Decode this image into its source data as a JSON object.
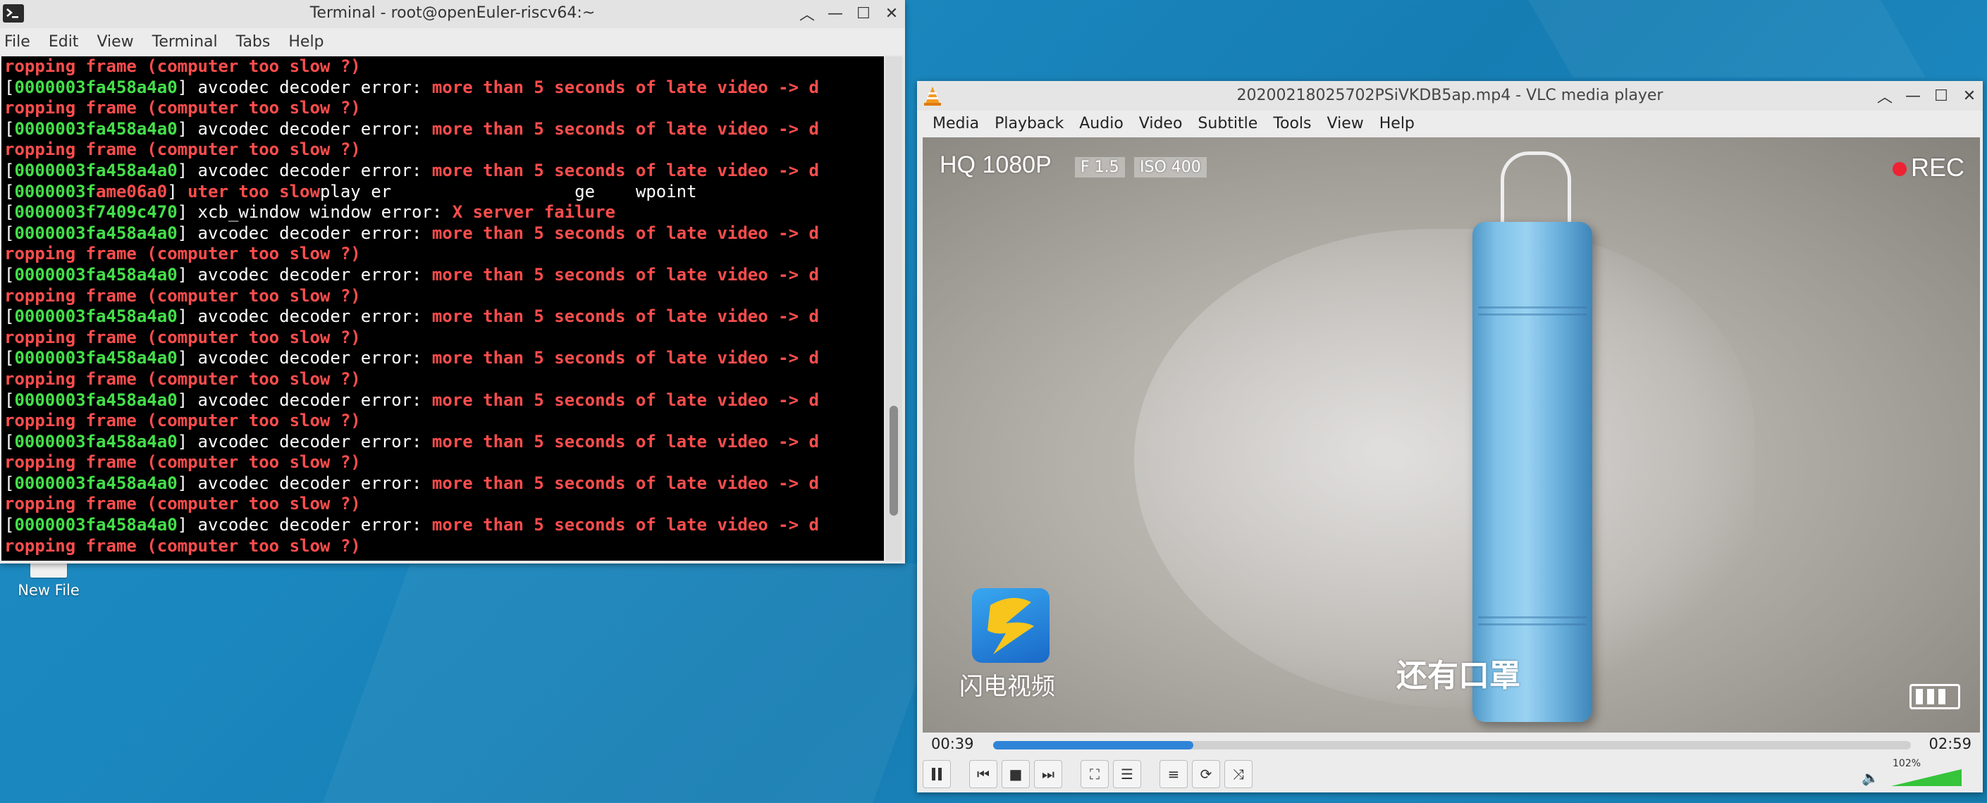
{
  "desktop": {
    "icon_label": "New File"
  },
  "terminal": {
    "title": "Terminal - root@openEuler-riscv64:~",
    "menu": [
      "File",
      "Edit",
      "View",
      "Terminal",
      "Tabs",
      "Help"
    ],
    "lines": [
      [
        {
          "t": "ropping frame (computer too slow ?)",
          "c": "red"
        }
      ],
      [
        {
          "t": "[",
          "c": "wht"
        },
        {
          "t": "0000003fa458a4a0",
          "c": "id"
        },
        {
          "t": "] avcodec decoder error: ",
          "c": "wht"
        },
        {
          "t": "more than 5 seconds of late video -> d",
          "c": "red"
        }
      ],
      [
        {
          "t": "ropping frame (computer too slow ?)",
          "c": "red"
        }
      ],
      [
        {
          "t": "[",
          "c": "wht"
        },
        {
          "t": "0000003fa458a4a0",
          "c": "id"
        },
        {
          "t": "] avcodec decoder error: ",
          "c": "wht"
        },
        {
          "t": "more than 5 seconds of late video -> d",
          "c": "red"
        }
      ],
      [
        {
          "t": "ropping frame (computer too slow ?)",
          "c": "red"
        }
      ],
      [
        {
          "t": "[",
          "c": "wht"
        },
        {
          "t": "0000003fa458a4a0",
          "c": "id"
        },
        {
          "t": "] avcodec decoder error: ",
          "c": "wht"
        },
        {
          "t": "more than 5 seconds of late video -> d",
          "c": "red"
        }
      ],
      [
        {
          "t": "[",
          "c": "wht"
        },
        {
          "t": "0000003f",
          "c": "id"
        },
        {
          "t": "ame06a0",
          "c": "red"
        },
        {
          "t": "] ",
          "c": "wht"
        },
        {
          "t": "uter too slow",
          "c": "red"
        },
        {
          "t": "play er          ",
          "c": "wht"
        },
        {
          "t": "        ge    wpoint",
          "c": "wht"
        }
      ],
      [
        {
          "t": "[",
          "c": "wht"
        },
        {
          "t": "0000003f7409c470",
          "c": "id"
        },
        {
          "t": "] xcb_window window error: ",
          "c": "wht"
        },
        {
          "t": "X server failure",
          "c": "red"
        }
      ],
      [
        {
          "t": "[",
          "c": "wht"
        },
        {
          "t": "0000003fa458a4a0",
          "c": "id"
        },
        {
          "t": "] avcodec decoder error: ",
          "c": "wht"
        },
        {
          "t": "more than 5 seconds of late video -> d",
          "c": "red"
        }
      ],
      [
        {
          "t": "ropping frame (computer too slow ?)",
          "c": "red"
        }
      ],
      [
        {
          "t": "[",
          "c": "wht"
        },
        {
          "t": "0000003fa458a4a0",
          "c": "id"
        },
        {
          "t": "] avcodec decoder error: ",
          "c": "wht"
        },
        {
          "t": "more than 5 seconds of late video -> d",
          "c": "red"
        }
      ],
      [
        {
          "t": "ropping frame (computer too slow ?)",
          "c": "red"
        }
      ],
      [
        {
          "t": "[",
          "c": "wht"
        },
        {
          "t": "0000003fa458a4a0",
          "c": "id"
        },
        {
          "t": "] avcodec decoder error: ",
          "c": "wht"
        },
        {
          "t": "more than 5 seconds of late video -> d",
          "c": "red"
        }
      ],
      [
        {
          "t": "ropping frame (computer too slow ?)",
          "c": "red"
        }
      ],
      [
        {
          "t": "[",
          "c": "wht"
        },
        {
          "t": "0000003fa458a4a0",
          "c": "id"
        },
        {
          "t": "] avcodec decoder error: ",
          "c": "wht"
        },
        {
          "t": "more than 5 seconds of late video -> d",
          "c": "red"
        }
      ],
      [
        {
          "t": "ropping frame (computer too slow ?)",
          "c": "red"
        }
      ],
      [
        {
          "t": "[",
          "c": "wht"
        },
        {
          "t": "0000003fa458a4a0",
          "c": "id"
        },
        {
          "t": "] avcodec decoder error: ",
          "c": "wht"
        },
        {
          "t": "more than 5 seconds of late video -> d",
          "c": "red"
        }
      ],
      [
        {
          "t": "ropping frame (computer too slow ?)",
          "c": "red"
        }
      ],
      [
        {
          "t": "[",
          "c": "wht"
        },
        {
          "t": "0000003fa458a4a0",
          "c": "id"
        },
        {
          "t": "] avcodec decoder error: ",
          "c": "wht"
        },
        {
          "t": "more than 5 seconds of late video -> d",
          "c": "red"
        }
      ],
      [
        {
          "t": "ropping frame (computer too slow ?)",
          "c": "red"
        }
      ],
      [
        {
          "t": "[",
          "c": "wht"
        },
        {
          "t": "0000003fa458a4a0",
          "c": "id"
        },
        {
          "t": "] avcodec decoder error: ",
          "c": "wht"
        },
        {
          "t": "more than 5 seconds of late video -> d",
          "c": "red"
        }
      ],
      [
        {
          "t": "ropping frame (computer too slow ?)",
          "c": "red"
        }
      ],
      [
        {
          "t": "[",
          "c": "wht"
        },
        {
          "t": "0000003fa458a4a0",
          "c": "id"
        },
        {
          "t": "] avcodec decoder error: ",
          "c": "wht"
        },
        {
          "t": "more than 5 seconds of late video -> d",
          "c": "red"
        }
      ],
      [
        {
          "t": "ropping frame (computer too slow ?)",
          "c": "red"
        }
      ]
    ],
    "colors": {
      "id": "#44e04a",
      "red": "#ff4d4d",
      "wht": "#ffffff"
    }
  },
  "vlc": {
    "title": "20200218025702PSiVKDB5ap.mp4 - VLC media player",
    "menu": [
      "Media",
      "Playback",
      "Audio",
      "Video",
      "Subtitle",
      "Tools",
      "View",
      "Help"
    ],
    "overlay": {
      "quality": "HQ 1080P",
      "fstop": "F 1.5",
      "iso": "ISO 400",
      "rec": "REC",
      "brand": "闪电视频",
      "subtitle": "还有口罩"
    },
    "time_elapsed": "00:39",
    "time_total": "02:59",
    "progress_fraction": 0.218,
    "volume_label": "102%",
    "volume_fraction": 1.02,
    "accent": "#3084d8"
  }
}
